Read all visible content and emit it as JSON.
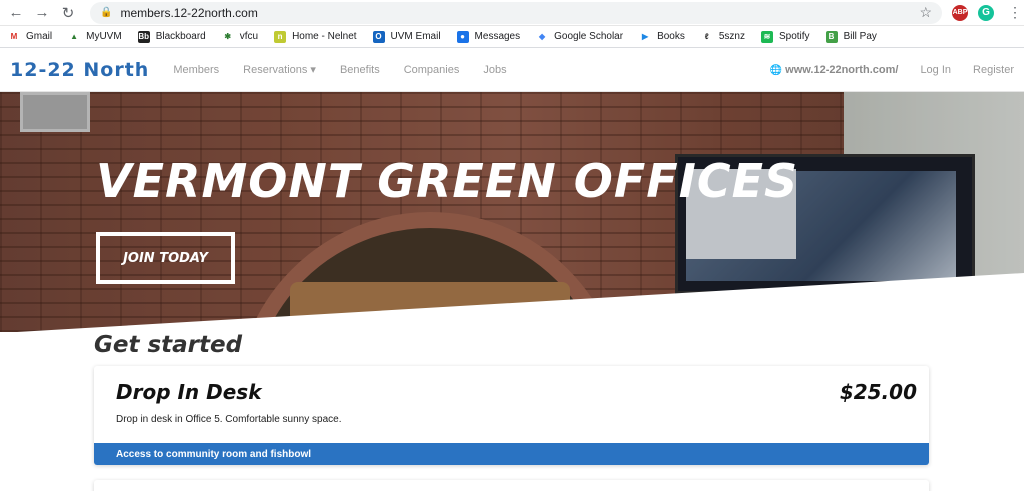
{
  "browser": {
    "url": "members.12-22north.com",
    "extensions": {
      "abp": "ABP",
      "grammarly": "G"
    }
  },
  "bookmarks": [
    {
      "label": "Gmail",
      "icon": "gmail-icon",
      "icon_text": "M",
      "color": "#ffffff",
      "fg": "#d93025"
    },
    {
      "label": "MyUVM",
      "icon": "tree-icon",
      "icon_text": "▲",
      "color": "#ffffff",
      "fg": "#2e7d32"
    },
    {
      "label": "Blackboard",
      "icon": "blackboard-icon",
      "icon_text": "Bb",
      "color": "#222222",
      "fg": "#ffffff"
    },
    {
      "label": "vfcu",
      "icon": "vfcu-icon",
      "icon_text": "✱",
      "color": "#ffffff",
      "fg": "#2e7d32"
    },
    {
      "label": "Home - Nelnet",
      "icon": "nelnet-icon",
      "icon_text": "n",
      "color": "#c0ca33",
      "fg": "#ffffff"
    },
    {
      "label": "UVM Email",
      "icon": "outlook-icon",
      "icon_text": "O",
      "color": "#1565c0",
      "fg": "#ffffff"
    },
    {
      "label": "Messages",
      "icon": "messages-icon",
      "icon_text": "●",
      "color": "#1a73e8",
      "fg": "#ffffff"
    },
    {
      "label": "Google Scholar",
      "icon": "scholar-icon",
      "icon_text": "◆",
      "color": "#ffffff",
      "fg": "#4285f4"
    },
    {
      "label": "Books",
      "icon": "play-books-icon",
      "icon_text": "▶",
      "color": "#ffffff",
      "fg": "#1e88e5"
    },
    {
      "label": "5sznz",
      "icon": "5sznz-icon",
      "icon_text": "ℓ",
      "color": "#ffffff",
      "fg": "#222222"
    },
    {
      "label": "Spotify",
      "icon": "spotify-icon",
      "icon_text": "≋",
      "color": "#1db954",
      "fg": "#ffffff"
    },
    {
      "label": "Bill Pay",
      "icon": "bill-pay-icon",
      "icon_text": "B",
      "color": "#43a047",
      "fg": "#ffffff"
    }
  ],
  "site_nav": {
    "logo": "12-22 North",
    "links": [
      "Members",
      "Reservations ▾",
      "Benefits",
      "Companies",
      "Jobs"
    ],
    "site_link": "www.12-22north.com/",
    "login": "Log In",
    "register": "Register"
  },
  "hero": {
    "title": "VERMONT GREEN OFFICES",
    "cta": "JOIN TODAY"
  },
  "main": {
    "section_title": "Get started",
    "cards": [
      {
        "title": "Drop In Desk",
        "price": "$25.00",
        "description": "Drop in desk in Office 5. Comfortable sunny space.",
        "footer": "Access to community room and fishbowl"
      }
    ]
  },
  "colors": {
    "brand": "#2a6ab1",
    "card_footer": "#2a73c2"
  }
}
